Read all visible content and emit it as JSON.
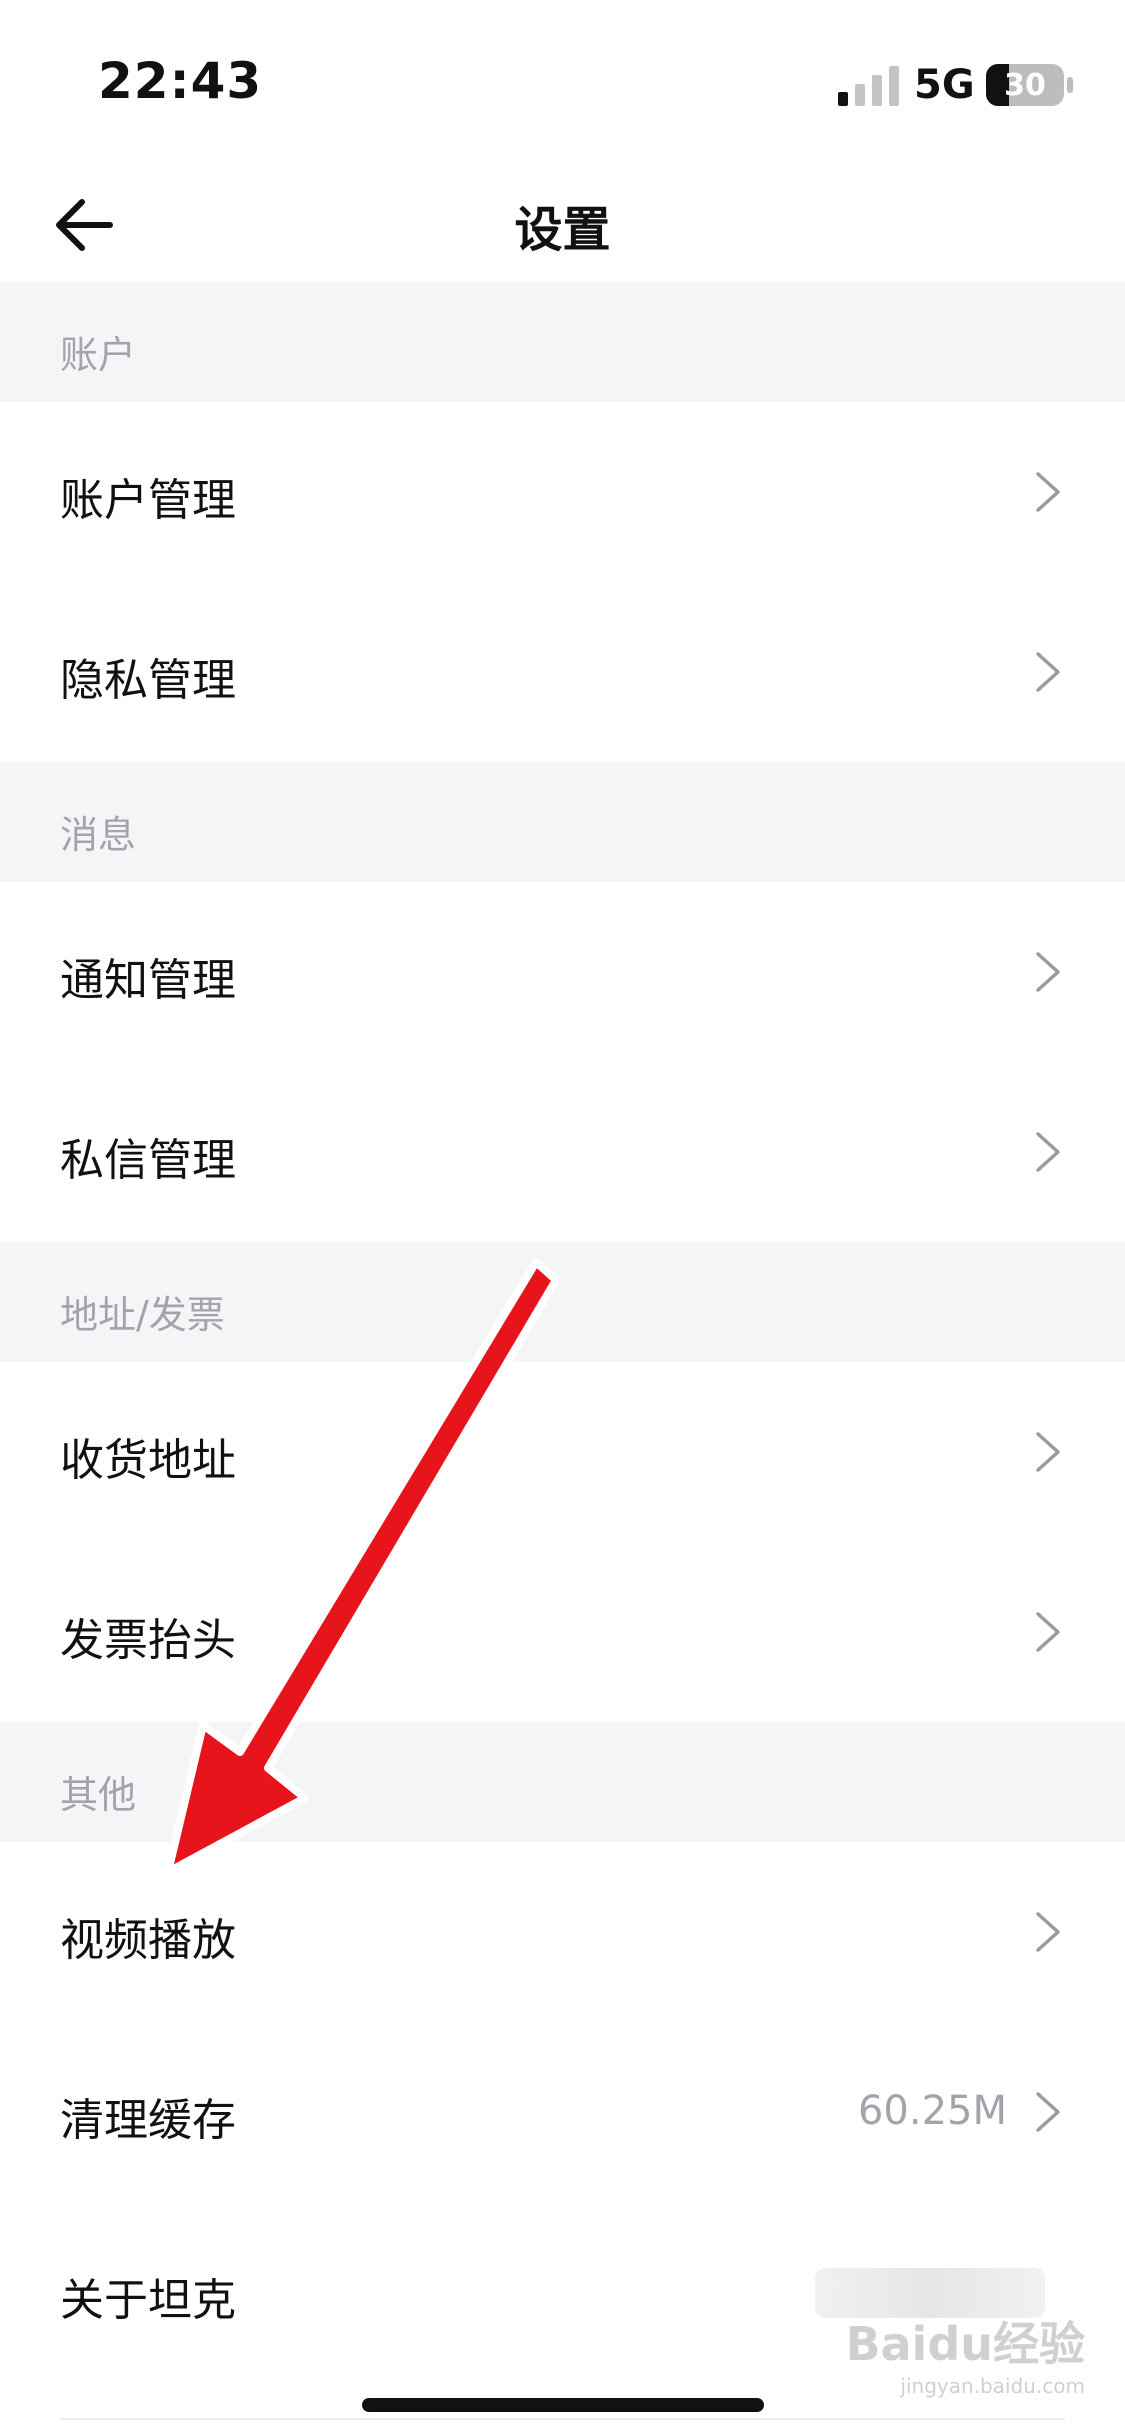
{
  "status_bar": {
    "time": "22:43",
    "network": "5G",
    "battery_level": "30",
    "battery_fraction": 0.3
  },
  "nav": {
    "title": "设置"
  },
  "sections": [
    {
      "header": "账户",
      "items": [
        {
          "label": "账户管理"
        },
        {
          "label": "隐私管理"
        }
      ]
    },
    {
      "header": "消息",
      "items": [
        {
          "label": "通知管理"
        },
        {
          "label": "私信管理"
        }
      ]
    },
    {
      "header": "地址/发票",
      "items": [
        {
          "label": "收货地址"
        },
        {
          "label": "发票抬头"
        }
      ]
    },
    {
      "header": "其他",
      "items": [
        {
          "label": "视频播放"
        },
        {
          "label": "清理缓存",
          "value": "60.25M"
        },
        {
          "label": "关于坦克"
        }
      ]
    }
  ],
  "watermark": {
    "text": "Baidu经验",
    "sub": "jingyan.baidu.com"
  },
  "colors": {
    "section_bg": "#f5f5f7",
    "muted_text": "#a3a3ab",
    "annotation_arrow": "#e8141c"
  }
}
